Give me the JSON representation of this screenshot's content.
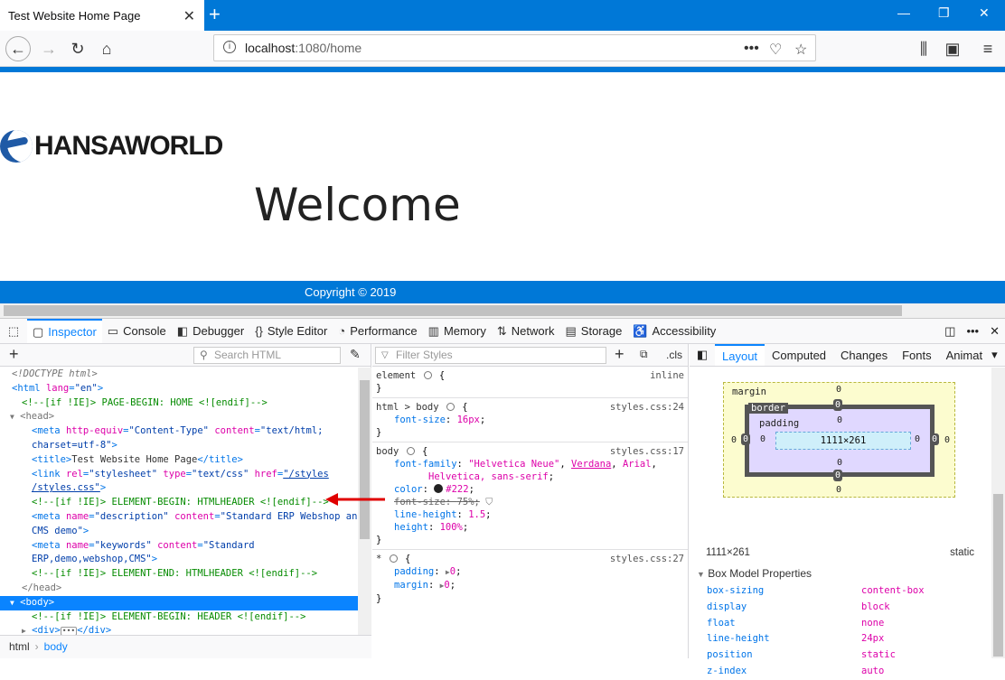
{
  "browser": {
    "tab_title": "Test Website Home Page",
    "url_host": "localhost",
    "url_rest": ":1080/home",
    "accent_color": "#0078d7"
  },
  "page": {
    "logo_text": "HANSAWORLD",
    "welcome": "Welcome",
    "footer": "Copyright © 2019"
  },
  "devtools": {
    "tabs": [
      {
        "icon": "inspector-icon",
        "label": "Inspector"
      },
      {
        "icon": "console-icon",
        "label": "Console"
      },
      {
        "icon": "debugger-icon",
        "label": "Debugger"
      },
      {
        "icon": "style-editor-icon",
        "label": "Style Editor"
      },
      {
        "icon": "performance-icon",
        "label": "Performance"
      },
      {
        "icon": "memory-icon",
        "label": "Memory"
      },
      {
        "icon": "network-icon",
        "label": "Network"
      },
      {
        "icon": "storage-icon",
        "label": "Storage"
      },
      {
        "icon": "accessibility-icon",
        "label": "Accessibility"
      }
    ],
    "search_html_placeholder": "Search HTML",
    "filter_styles_placeholder": "Filter Styles",
    "cls_label": ".cls",
    "breadcrumbs": [
      "html",
      "body"
    ],
    "layout_tabs": [
      "Layout",
      "Computed",
      "Changes",
      "Fonts",
      "Animat"
    ]
  },
  "markup": {
    "doctype": "<!DOCTYPE html>",
    "html_open_tag": "<html ",
    "html_attr": "lang",
    "html_attr_val": "\"en\"",
    "html_close": ">",
    "c1": "<!--[if !IE]> PAGE-BEGIN: HOME <![endif]-->",
    "head": "<head>",
    "meta1_a": "<meta ",
    "meta1_attr1": "http-equiv",
    "meta1_val1": "\"Content-Type\"",
    "meta1_attr2": "content",
    "meta1_val2a": "\"text/html;",
    "meta1_val2b": "charset=utf-8\"",
    "meta1_end": ">",
    "title_line_a": "<title>",
    "title_text": "Test Website Home Page",
    "title_line_b": "</title>",
    "link_a": "<link ",
    "link_attr1": "rel",
    "link_val1": "\"stylesheet\"",
    "link_attr2": "type",
    "link_val2": "\"text/css\"",
    "link_attr3": "href",
    "link_val3a": "\"/styles",
    "link_val3b": "/styles.css\"",
    "link_end": ">",
    "c2": "<!--[if !IE]> ELEMENT-BEGIN: HTMLHEADER <![endif]-->",
    "meta2_a": "<meta ",
    "meta2_attr1": "name",
    "meta2_val1": "\"description\"",
    "meta2_attr2": "content",
    "meta2_val2a": "\"Standard ERP Webshop and",
    "meta2_val2b": "CMS demo\"",
    "meta2_end": ">",
    "meta3_a": "<meta ",
    "meta3_attr1": "name",
    "meta3_val1": "\"keywords\"",
    "meta3_attr2": "content",
    "meta3_val2a": "\"Standard",
    "meta3_val2b": "ERP,demo,webshop,CMS\"",
    "meta3_end": ">",
    "c3": "<!--[if !IE]> ELEMENT-END: HTMLHEADER <![endif]-->",
    "head_close": "</head>",
    "body": "<body>",
    "c4": "<!--[if !IE]> ELEMENT-BEGIN: HEADER <![endif]-->",
    "div_open": "<div>",
    "div_close": "</div>"
  },
  "rules": [
    {
      "selector": "element",
      "source": "inline"
    },
    {
      "selector": "html > body",
      "source": "styles.css:24"
    },
    {
      "selector": "body",
      "source": "styles.css:17"
    },
    {
      "selector": "*",
      "source": "styles.css:27"
    }
  ],
  "decls": {
    "r2_prop": "font-size",
    "r2_val": "16px",
    "ff_prop": "font-family",
    "ff_val1": "\"Helvetica Neue\"",
    "ff_val2": "Verdana",
    "ff_val3": "Arial",
    "ff_val4": "Helvetica, sans-serif",
    "color_prop": "color",
    "color_val": "#222",
    "fs_prop": "font-size",
    "fs_val": "75%",
    "lh_prop": "line-height",
    "lh_val": "1.5",
    "h_prop": "height",
    "h_val": "100%",
    "pad_prop": "padding",
    "pad_val": "0",
    "mar_prop": "margin",
    "mar_val": "0"
  },
  "boxmodel": {
    "margin_label": "margin",
    "border_label": "border",
    "padding_label": "padding",
    "content": "1111×261",
    "zero": "0",
    "dims": "1111×261",
    "position": "static",
    "props_header": "Box Model Properties",
    "props": [
      {
        "name": "box-sizing",
        "value": "content-box"
      },
      {
        "name": "display",
        "value": "block"
      },
      {
        "name": "float",
        "value": "none"
      },
      {
        "name": "line-height",
        "value": "24px"
      },
      {
        "name": "position",
        "value": "static"
      },
      {
        "name": "z-index",
        "value": "auto"
      }
    ]
  }
}
